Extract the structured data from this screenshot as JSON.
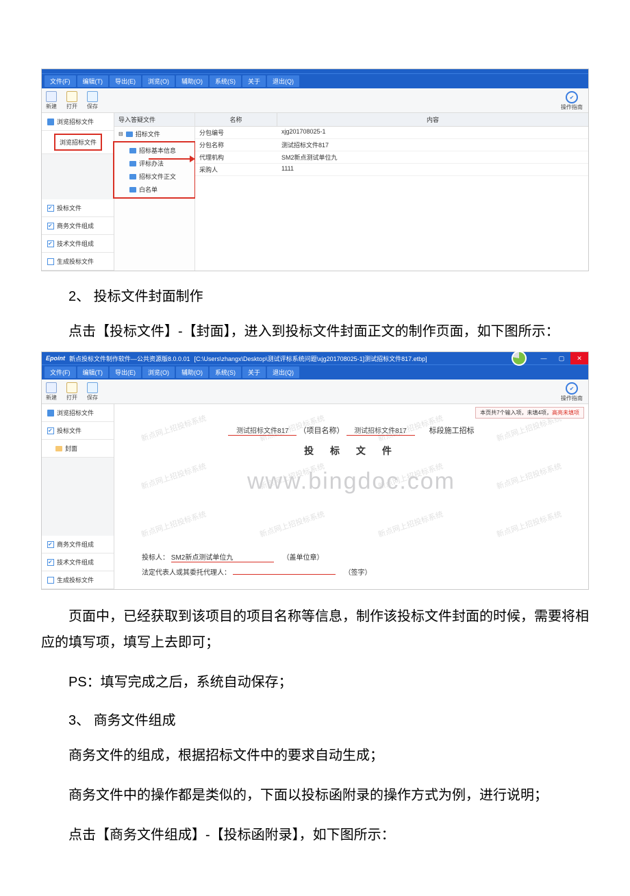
{
  "shot1": {
    "menubar": [
      "文件(F)",
      "编辑(T)",
      "导出(E)",
      "浏览(O)",
      "辅助(O)",
      "系统(S)",
      "关于",
      "退出(Q)"
    ],
    "toolbar": {
      "b1": "新建",
      "b2": "打开",
      "b3": "保存",
      "help_label": "操作指南"
    },
    "side": {
      "items": [
        {
          "label": "浏览招标文件",
          "chk": true
        },
        {
          "label": "浏览招标文件",
          "indent": true,
          "highlight": true
        },
        {
          "label": "投标文件",
          "chk": true,
          "bottom": true
        },
        {
          "label": "商务文件组成",
          "chk": true,
          "bottom": true
        },
        {
          "label": "技术文件组成",
          "chk": true,
          "bottom": true
        },
        {
          "label": "生成投标文件",
          "chk": false,
          "bottom": true
        }
      ]
    },
    "tree": {
      "head": "导入答疑文件",
      "root": "招标文件",
      "children": [
        "招标基本信息",
        "评标办法",
        "招标文件正文",
        "白名单"
      ]
    },
    "table": {
      "headers": [
        "名称",
        "内容"
      ],
      "rows": [
        {
          "name": "分包编号",
          "val": "xjg201708025-1"
        },
        {
          "name": "分包名称",
          "val": "测试招标文件817"
        },
        {
          "name": "代理机构",
          "val": "SM2新点测试单位九"
        },
        {
          "name": "采购人",
          "val": "1111"
        }
      ]
    }
  },
  "doc": {
    "sec2_title": "2、 投标文件封面制作",
    "sec2_p1": "点击【投标文件】-【封面】，进入到投标文件封面正文的制作页面，如下图所示：",
    "after2_p1": "页面中，已经获取到该项目的项目名称等信息，制作该投标文件封面的时候，需要将相应的填写项，填写上去即可；",
    "after2_p2": "PS：填写完成之后，系统自动保存；",
    "sec3_title": "3、 商务文件组成",
    "sec3_p1": "商务文件的组成，根据招标文件中的要求自动生成；",
    "sec3_p2": "商务文件中的操作都是类似的，下面以投标函附录的操作方式为例，进行说明；",
    "sec3_p3": "点击【商务文件组成】-【投标函附录】，如下图所示："
  },
  "shot2": {
    "titlebar": {
      "brand": "Epoint",
      "title": "新点投标文件制作软件—公共资源版8.0.0.01",
      "path": "[C:\\Users\\zhangx\\Desktop\\测试评标系统问题\\xjg201708025-1]测试招标文件817.etbp]"
    },
    "menubar": [
      "文件(F)",
      "编辑(T)",
      "导出(E)",
      "浏览(O)",
      "辅助(O)",
      "系统(S)",
      "关于",
      "退出(Q)"
    ],
    "toolbar": {
      "b1": "新建",
      "b2": "打开",
      "b3": "保存",
      "help_label": "操作指南"
    },
    "side": {
      "items": [
        {
          "label": "浏览招标文件",
          "chk": true
        },
        {
          "label": "投标文件",
          "chk": true
        },
        {
          "label": "封面",
          "folder": true,
          "active": true
        },
        {
          "label": "商务文件组成",
          "chk": true,
          "bottom": true
        },
        {
          "label": "技术文件组成",
          "chk": true,
          "bottom": true
        },
        {
          "label": "生成投标文件",
          "chk": false,
          "bottom": true
        }
      ]
    },
    "tip": {
      "pre": "本页共7个输入项，未填4项，",
      "link": "高亮未填项"
    },
    "form": {
      "proj1": "测试招标文件817",
      "proj_label": "（项目名称）",
      "proj2": "测试招标文件817",
      "suffix": "标段施工招标",
      "big_title": "投 标 文 件",
      "bidder_label": "投标人：",
      "bidder_val": "SM2新点测试单位九",
      "stamp": "（盖单位章）",
      "legal_label": "法定代表人或其委托代理人：",
      "sign": "（签字）"
    },
    "watermark_text": "新点网上招投标系统",
    "domain_wm": "www.bingdoc.com"
  }
}
